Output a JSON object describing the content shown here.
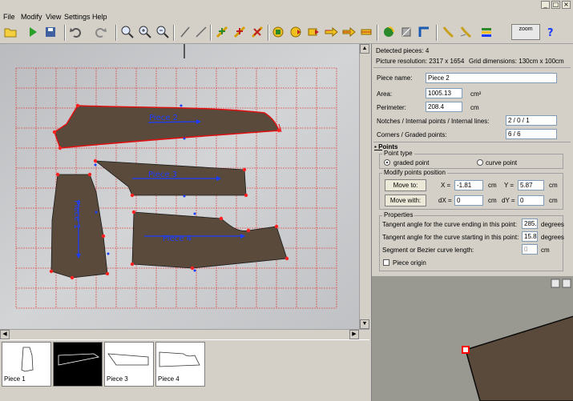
{
  "window": {
    "controls": [
      "_",
      "□",
      "×"
    ]
  },
  "menu": [
    "File",
    "Modify",
    "View",
    "Settings",
    "Help"
  ],
  "toolbar": {
    "zoom_label": "zoom"
  },
  "info": {
    "detected_pieces": "Detected pieces: 4",
    "resolution": "Picture resolution: 2317 x 1654",
    "grid": "Grid dimensions: 130cm x 100cm"
  },
  "piece": {
    "name_label": "Piece name:",
    "name_value": "Piece 2",
    "area_label": "Area:",
    "area_value": "1005.13",
    "area_unit": "cm²",
    "perimeter_label": "Perimeter:",
    "perimeter_value": "208.4",
    "perimeter_unit": "cm",
    "notches_label": "Notches / Internal points / Internal lines:",
    "notches_value": "2 / 0 / 1",
    "corners_label": "Corners / Graded points:",
    "corners_value": "6 / 6"
  },
  "points": {
    "section_label": "Points",
    "point_type_title": "Point type",
    "graded": "graded point",
    "curve": "curve point",
    "modify_title": "Modify points position",
    "move_to": "Move to:",
    "x_label": "X =",
    "x_value": "-1.81",
    "y_label": "Y =",
    "y_value": "5.87",
    "move_with": "Move with:",
    "dx_label": "dX =",
    "dx_value": "0",
    "dy_label": "dY =",
    "dy_value": "0",
    "unit": "cm",
    "properties_title": "Properties",
    "tan_end_label": "Tangent angle for the curve ending in this point:",
    "tan_end_value": "285.2",
    "tan_start_label": "Tangent angle for the curve starting in this point:",
    "tan_start_value": "15.88",
    "degrees": "degrees",
    "segment_label": "Segment or Bezier curve length:",
    "segment_value": "0",
    "origin_label": "Piece origin"
  },
  "canvas_labels": [
    "Piece 1",
    "Piece 2",
    "Piece 3",
    "Piece 4"
  ],
  "thumbnails": [
    {
      "label": "Piece 1"
    },
    {
      "label": "Piece 2"
    },
    {
      "label": "Piece 3"
    },
    {
      "label": "Piece 4"
    }
  ],
  "colors": {
    "grid": "#e04040",
    "piece_fill": "#5a4a3c",
    "axis": "#1a3cff",
    "selected_outline": "#e01010"
  }
}
